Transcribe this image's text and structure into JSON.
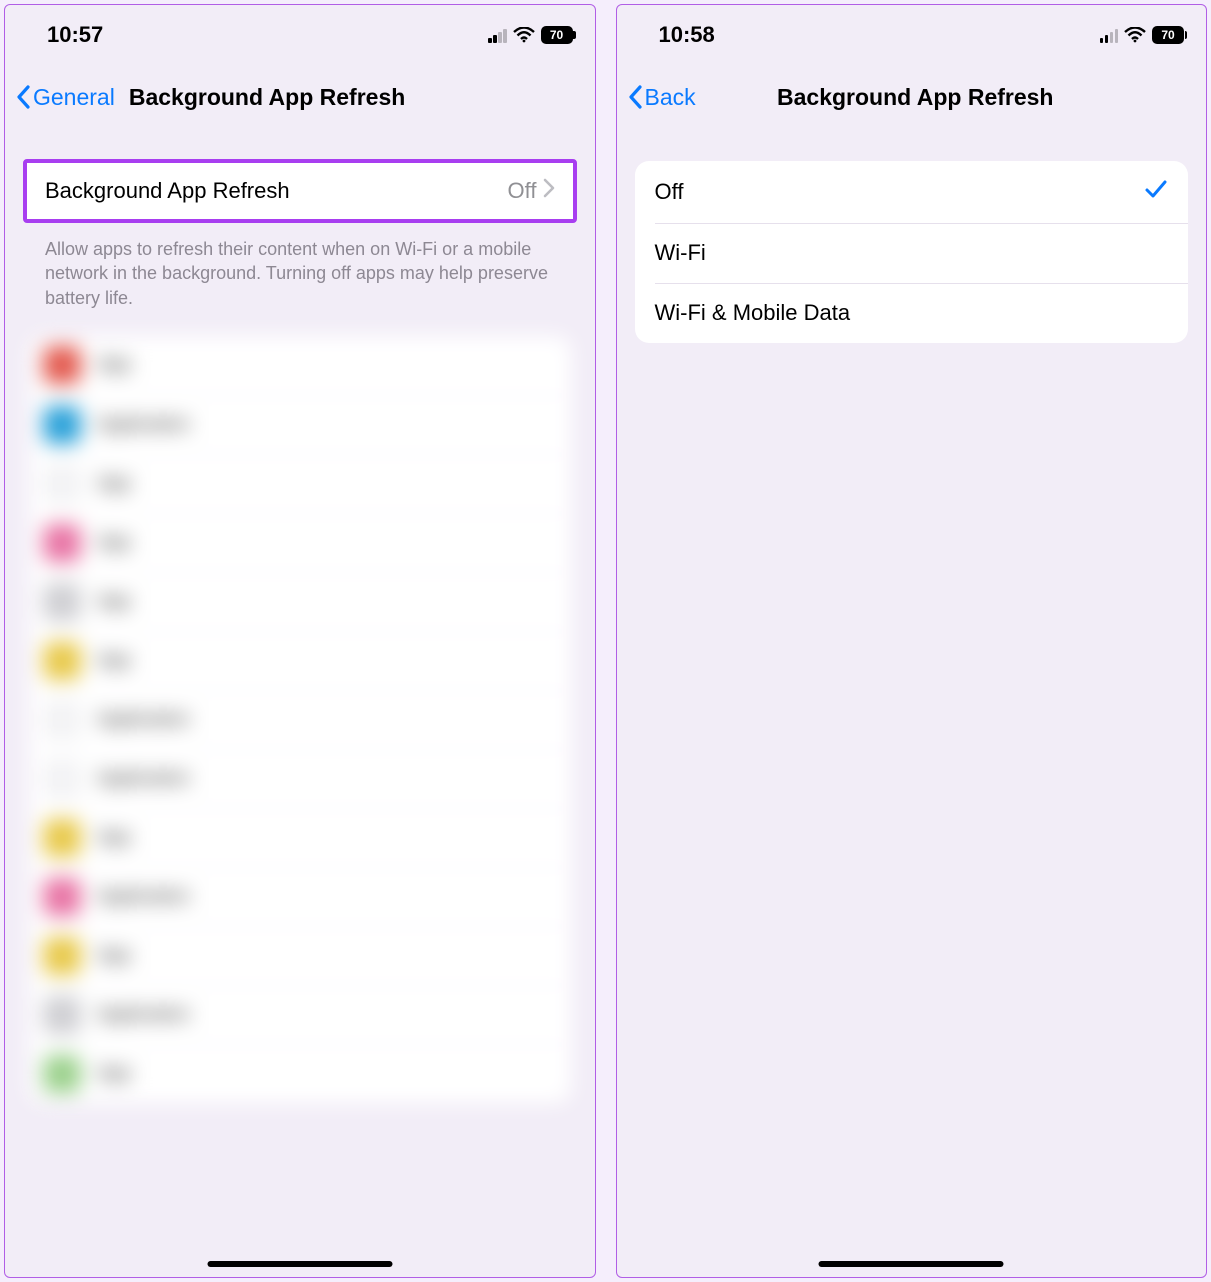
{
  "left": {
    "status": {
      "time": "10:57",
      "battery": "70"
    },
    "nav": {
      "back": "General",
      "title": "Background App Refresh"
    },
    "mainRow": {
      "label": "Background App Refresh",
      "value": "Off"
    },
    "footer": "Allow apps to refresh their content when on Wi-Fi or a mobile network in the background. Turning off apps may help preserve battery life."
  },
  "right": {
    "status": {
      "time": "10:58",
      "battery": "70"
    },
    "nav": {
      "back": "Back",
      "title": "Background App Refresh"
    },
    "options": [
      {
        "label": "Off",
        "selected": true
      },
      {
        "label": "Wi-Fi",
        "selected": false
      },
      {
        "label": "Wi-Fi & Mobile Data",
        "selected": false
      }
    ]
  }
}
